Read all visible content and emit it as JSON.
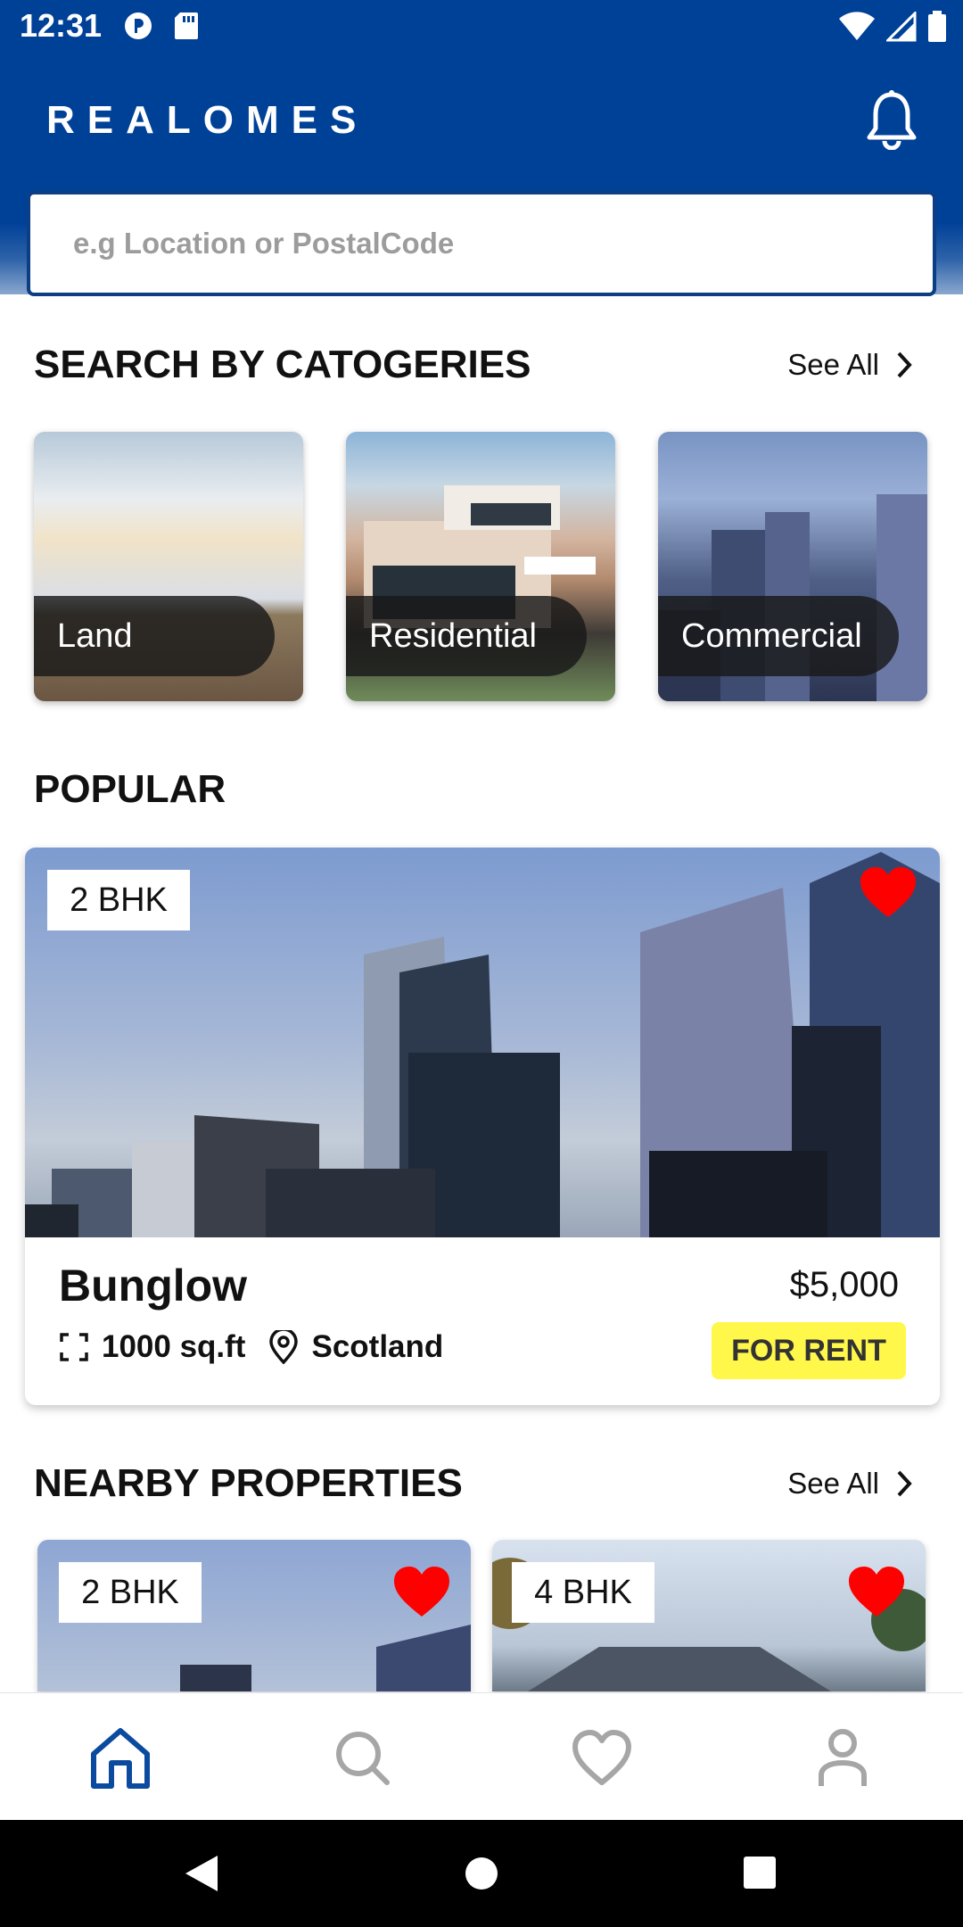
{
  "status_bar": {
    "time": "12:31"
  },
  "header": {
    "brand": "REALOMES"
  },
  "search": {
    "placeholder": "e.g Location or PostalCode"
  },
  "categories": {
    "title": "SEARCH BY CATOGERIES",
    "see_all": "See All",
    "items": [
      {
        "label": "Land"
      },
      {
        "label": "Residential"
      },
      {
        "label": "Commercial"
      }
    ]
  },
  "popular": {
    "title": "POPULAR",
    "card": {
      "bhk": "2 BHK",
      "name": "Bunglow",
      "price": "$5,000",
      "area": "1000 sq.ft",
      "location": "Scotland",
      "badge": "FOR RENT"
    }
  },
  "nearby": {
    "title": "NEARBY PROPERTIES",
    "see_all": "See All",
    "items": [
      {
        "bhk": "2 BHK"
      },
      {
        "bhk": "4 BHK"
      }
    ]
  },
  "colors": {
    "primary": "#004198",
    "badge": "#fff74a",
    "heart": "#ff0000",
    "nav_active": "#0b4a9e",
    "nav_inactive": "#a6a6a6"
  },
  "icons": [
    "bell-icon",
    "chevron-right-icon",
    "heart-icon",
    "expand-icon",
    "location-pin-icon",
    "home-icon",
    "search-icon",
    "heart-outline-icon",
    "profile-icon"
  ]
}
